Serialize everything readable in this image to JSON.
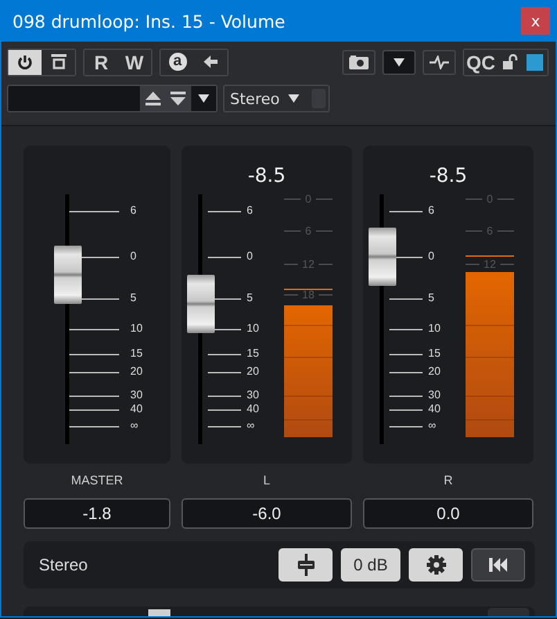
{
  "window": {
    "title": "098 drumloop: Ins. 15 - Volume",
    "close": "x"
  },
  "toolbar": {
    "power": {
      "on": true
    },
    "bypass": {
      "on": false
    },
    "read": {
      "label": "R"
    },
    "write": {
      "label": "W"
    },
    "automation": {
      "label": "a"
    },
    "qc": {
      "label": "QC"
    }
  },
  "preset_bar": {
    "channel_select": {
      "value": "Stereo"
    }
  },
  "channels": [
    {
      "kind": "master",
      "name": "MASTER",
      "value": "-1.8",
      "fader": {
        "level": 0.68
      },
      "fader_scale": [
        "6",
        "0",
        "5",
        "10",
        "15",
        "20",
        "30",
        "40",
        "∞"
      ]
    },
    {
      "kind": "meter",
      "name": "L",
      "value": "-6.0",
      "peak": "-8.5",
      "fader": {
        "level": 0.56
      },
      "fader_scale": [
        "6",
        "0",
        "5",
        "10",
        "15",
        "20",
        "30",
        "40",
        "∞"
      ],
      "meter": {
        "level": 0.55,
        "peak_hold": {
          "level": 0.62
        },
        "scale": [
          "0",
          "6",
          "12",
          "18"
        ]
      }
    },
    {
      "kind": "meter",
      "name": "R",
      "value": "0.0",
      "peak": "-8.5",
      "fader": {
        "level": 0.75
      },
      "fader_scale": [
        "6",
        "0",
        "5",
        "10",
        "15",
        "20",
        "30",
        "40",
        "∞"
      ],
      "meter": {
        "level": 0.69,
        "peak_hold": {
          "level": 0.76
        },
        "scale": [
          "0",
          "6",
          "12"
        ]
      }
    }
  ],
  "footer": {
    "label": "Stereo",
    "buttons": [
      {
        "kind": "fader",
        "on": true
      },
      {
        "kind": "text",
        "label": "0 dB",
        "on": true
      },
      {
        "kind": "settings",
        "on": true
      },
      {
        "kind": "reset",
        "on": false
      }
    ]
  }
}
